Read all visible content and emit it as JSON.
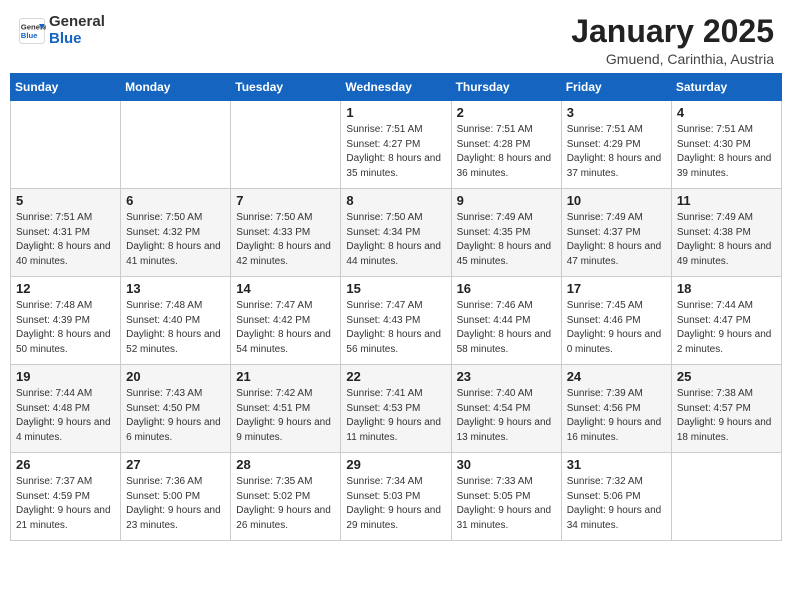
{
  "header": {
    "logo_general": "General",
    "logo_blue": "Blue",
    "month": "January 2025",
    "location": "Gmuend, Carinthia, Austria"
  },
  "weekdays": [
    "Sunday",
    "Monday",
    "Tuesday",
    "Wednesday",
    "Thursday",
    "Friday",
    "Saturday"
  ],
  "weeks": [
    [
      {
        "day": "",
        "info": ""
      },
      {
        "day": "",
        "info": ""
      },
      {
        "day": "",
        "info": ""
      },
      {
        "day": "1",
        "info": "Sunrise: 7:51 AM\nSunset: 4:27 PM\nDaylight: 8 hours\nand 35 minutes."
      },
      {
        "day": "2",
        "info": "Sunrise: 7:51 AM\nSunset: 4:28 PM\nDaylight: 8 hours\nand 36 minutes."
      },
      {
        "day": "3",
        "info": "Sunrise: 7:51 AM\nSunset: 4:29 PM\nDaylight: 8 hours\nand 37 minutes."
      },
      {
        "day": "4",
        "info": "Sunrise: 7:51 AM\nSunset: 4:30 PM\nDaylight: 8 hours\nand 39 minutes."
      }
    ],
    [
      {
        "day": "5",
        "info": "Sunrise: 7:51 AM\nSunset: 4:31 PM\nDaylight: 8 hours\nand 40 minutes."
      },
      {
        "day": "6",
        "info": "Sunrise: 7:50 AM\nSunset: 4:32 PM\nDaylight: 8 hours\nand 41 minutes."
      },
      {
        "day": "7",
        "info": "Sunrise: 7:50 AM\nSunset: 4:33 PM\nDaylight: 8 hours\nand 42 minutes."
      },
      {
        "day": "8",
        "info": "Sunrise: 7:50 AM\nSunset: 4:34 PM\nDaylight: 8 hours\nand 44 minutes."
      },
      {
        "day": "9",
        "info": "Sunrise: 7:49 AM\nSunset: 4:35 PM\nDaylight: 8 hours\nand 45 minutes."
      },
      {
        "day": "10",
        "info": "Sunrise: 7:49 AM\nSunset: 4:37 PM\nDaylight: 8 hours\nand 47 minutes."
      },
      {
        "day": "11",
        "info": "Sunrise: 7:49 AM\nSunset: 4:38 PM\nDaylight: 8 hours\nand 49 minutes."
      }
    ],
    [
      {
        "day": "12",
        "info": "Sunrise: 7:48 AM\nSunset: 4:39 PM\nDaylight: 8 hours\nand 50 minutes."
      },
      {
        "day": "13",
        "info": "Sunrise: 7:48 AM\nSunset: 4:40 PM\nDaylight: 8 hours\nand 52 minutes."
      },
      {
        "day": "14",
        "info": "Sunrise: 7:47 AM\nSunset: 4:42 PM\nDaylight: 8 hours\nand 54 minutes."
      },
      {
        "day": "15",
        "info": "Sunrise: 7:47 AM\nSunset: 4:43 PM\nDaylight: 8 hours\nand 56 minutes."
      },
      {
        "day": "16",
        "info": "Sunrise: 7:46 AM\nSunset: 4:44 PM\nDaylight: 8 hours\nand 58 minutes."
      },
      {
        "day": "17",
        "info": "Sunrise: 7:45 AM\nSunset: 4:46 PM\nDaylight: 9 hours\nand 0 minutes."
      },
      {
        "day": "18",
        "info": "Sunrise: 7:44 AM\nSunset: 4:47 PM\nDaylight: 9 hours\nand 2 minutes."
      }
    ],
    [
      {
        "day": "19",
        "info": "Sunrise: 7:44 AM\nSunset: 4:48 PM\nDaylight: 9 hours\nand 4 minutes."
      },
      {
        "day": "20",
        "info": "Sunrise: 7:43 AM\nSunset: 4:50 PM\nDaylight: 9 hours\nand 6 minutes."
      },
      {
        "day": "21",
        "info": "Sunrise: 7:42 AM\nSunset: 4:51 PM\nDaylight: 9 hours\nand 9 minutes."
      },
      {
        "day": "22",
        "info": "Sunrise: 7:41 AM\nSunset: 4:53 PM\nDaylight: 9 hours\nand 11 minutes."
      },
      {
        "day": "23",
        "info": "Sunrise: 7:40 AM\nSunset: 4:54 PM\nDaylight: 9 hours\nand 13 minutes."
      },
      {
        "day": "24",
        "info": "Sunrise: 7:39 AM\nSunset: 4:56 PM\nDaylight: 9 hours\nand 16 minutes."
      },
      {
        "day": "25",
        "info": "Sunrise: 7:38 AM\nSunset: 4:57 PM\nDaylight: 9 hours\nand 18 minutes."
      }
    ],
    [
      {
        "day": "26",
        "info": "Sunrise: 7:37 AM\nSunset: 4:59 PM\nDaylight: 9 hours\nand 21 minutes."
      },
      {
        "day": "27",
        "info": "Sunrise: 7:36 AM\nSunset: 5:00 PM\nDaylight: 9 hours\nand 23 minutes."
      },
      {
        "day": "28",
        "info": "Sunrise: 7:35 AM\nSunset: 5:02 PM\nDaylight: 9 hours\nand 26 minutes."
      },
      {
        "day": "29",
        "info": "Sunrise: 7:34 AM\nSunset: 5:03 PM\nDaylight: 9 hours\nand 29 minutes."
      },
      {
        "day": "30",
        "info": "Sunrise: 7:33 AM\nSunset: 5:05 PM\nDaylight: 9 hours\nand 31 minutes."
      },
      {
        "day": "31",
        "info": "Sunrise: 7:32 AM\nSunset: 5:06 PM\nDaylight: 9 hours\nand 34 minutes."
      },
      {
        "day": "",
        "info": ""
      }
    ]
  ]
}
